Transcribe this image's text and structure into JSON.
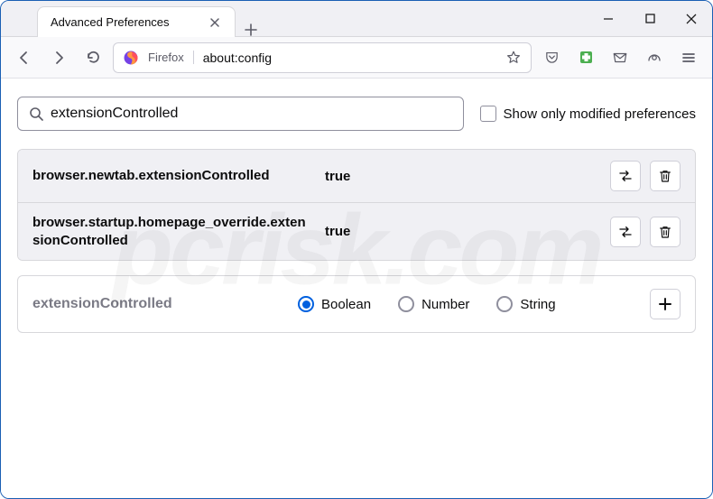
{
  "window": {
    "tab_title": "Advanced Preferences"
  },
  "toolbar": {
    "identity_label": "Firefox",
    "url": "about:config"
  },
  "search": {
    "value": "extensionControlled",
    "checkbox_label": "Show only modified preferences"
  },
  "prefs": [
    {
      "name": "browser.newtab.extensionControlled",
      "value": "true"
    },
    {
      "name": "browser.startup.homepage_override.extensionControlled",
      "value": "true"
    }
  ],
  "add_row": {
    "name": "extensionControlled",
    "options": {
      "boolean": "Boolean",
      "number": "Number",
      "string": "String"
    }
  },
  "watermark": "pcrisk.com"
}
